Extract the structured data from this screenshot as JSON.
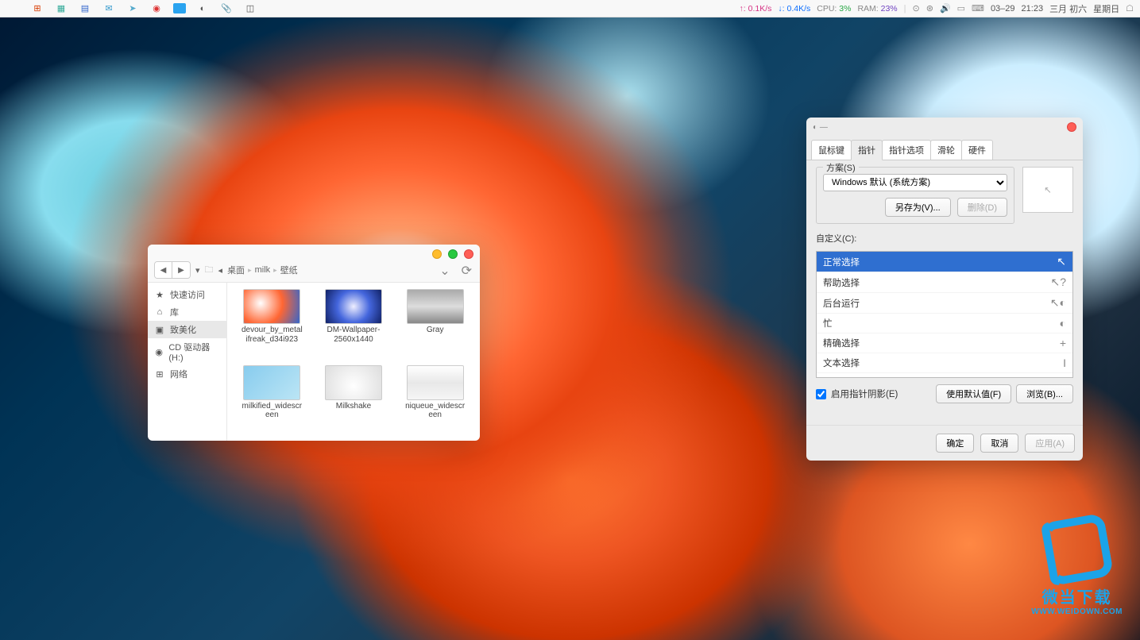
{
  "menubar": {
    "net_up": "↑: 0.1K/s",
    "net_down": "↓: 0.4K/s",
    "cpu_label": "CPU:",
    "cpu_val": "3%",
    "ram_label": "RAM:",
    "ram_val": "23%",
    "date": "03–29",
    "time": "21:23",
    "lunar": "三月 初六",
    "weekday": "星期日"
  },
  "finder": {
    "breadcrumb": [
      "桌面",
      "milk",
      "壁纸"
    ],
    "sidebar": [
      {
        "icon": "★",
        "label": "快速访问"
      },
      {
        "icon": "⌂",
        "label": "库"
      },
      {
        "icon": "▣",
        "label": "致美化"
      },
      {
        "icon": "◉",
        "label": "CD 驱动器 (H:)"
      },
      {
        "icon": "⊞",
        "label": "网络"
      }
    ],
    "files": [
      {
        "name": "devour_by_metalifreak_d34i923"
      },
      {
        "name": "DM-Wallpaper-2560x1440"
      },
      {
        "name": "Gray"
      },
      {
        "name": "milkified_widescreen"
      },
      {
        "name": "Milkshake"
      },
      {
        "name": "niqueue_widescreen"
      }
    ]
  },
  "props": {
    "tabs": [
      "鼠标键",
      "指针",
      "指针选项",
      "滑轮",
      "硬件"
    ],
    "active_tab": 1,
    "scheme_legend": "方案(S)",
    "scheme_value": "Windows 默认 (系统方案)",
    "save_as": "另存为(V)...",
    "delete": "删除(D)",
    "custom_label": "自定义(C):",
    "cursors": [
      {
        "label": "正常选择",
        "glyph": "↖"
      },
      {
        "label": "帮助选择",
        "glyph": "↖?"
      },
      {
        "label": "后台运行",
        "glyph": "↖◐"
      },
      {
        "label": "忙",
        "glyph": "◐"
      },
      {
        "label": "精确选择",
        "glyph": "+"
      },
      {
        "label": "文本选择",
        "glyph": "I"
      }
    ],
    "shadow_label": "启用指针阴影(E)",
    "use_default": "使用默认值(F)",
    "browse": "浏览(B)...",
    "ok": "确定",
    "cancel": "取消",
    "apply": "应用(A)"
  },
  "watermark": {
    "cn": "微当下载",
    "en": "WWW.WEIDOWN.COM"
  }
}
